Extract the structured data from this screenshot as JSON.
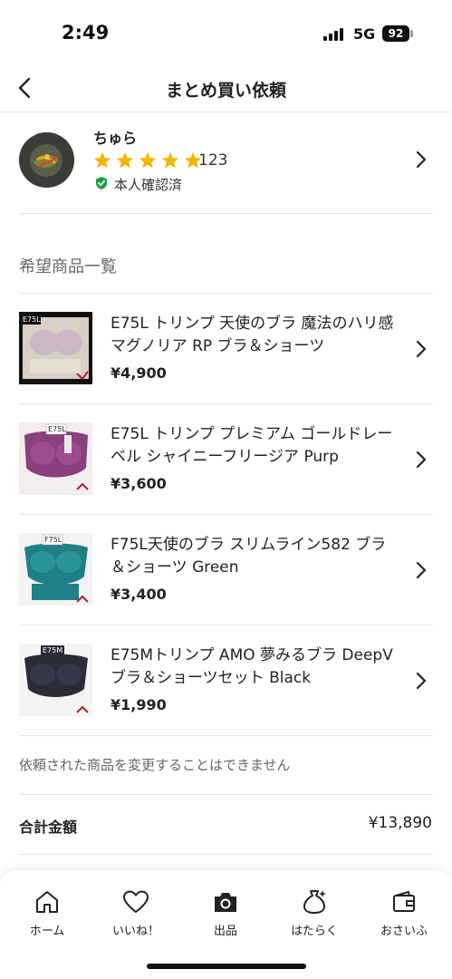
{
  "status_bar": {
    "time": "2:49",
    "network": "5G",
    "battery": "92"
  },
  "header": {
    "title": "まとめ買い依頼",
    "back_icon": "chevron-left-icon"
  },
  "seller": {
    "name": "ちゅら",
    "rating_stars": 5,
    "rating_count": "123",
    "verified_label": "本人確認済",
    "star_color": "#F5B400",
    "verified_color": "#1E9E3E"
  },
  "section_title": "希望商品一覧",
  "items": [
    {
      "title": "E75L トリンプ 天使のブラ 魔法のハリ感 マグノリア RP ブラ＆ショーツ",
      "price": "¥4,900",
      "thumb_color": "#d9cfc4",
      "thumb_label": "E75L"
    },
    {
      "title": "E75L トリンプ プレミアム ゴールドレーベル シャイニーフリージア Purp",
      "price": "¥3,600",
      "thumb_color": "#8a3f7f",
      "thumb_label": "E75L"
    },
    {
      "title": "F75L天使のブラ スリムライン582 ブラ＆ショーツ Green",
      "price": "¥3,400",
      "thumb_color": "#1f7f86",
      "thumb_label": "F75L"
    },
    {
      "title": "E75Mトリンプ AMO 夢みるブラ DeepV ブラ＆ショーツセット Black",
      "price": "¥1,990",
      "thumb_color": "#2a2d38",
      "thumb_label": "E75M"
    }
  ],
  "notice": "依頼された商品を変更することはできません",
  "total": {
    "label": "合計金額",
    "value": "¥13,890"
  },
  "tabbar": [
    {
      "label": "ホーム",
      "icon": "home-icon"
    },
    {
      "label": "いいね！",
      "icon": "heart-icon"
    },
    {
      "label": "出品",
      "icon": "camera-icon"
    },
    {
      "label": "はたらく",
      "icon": "money-bag-icon"
    },
    {
      "label": "おさいふ",
      "icon": "wallet-icon"
    }
  ]
}
